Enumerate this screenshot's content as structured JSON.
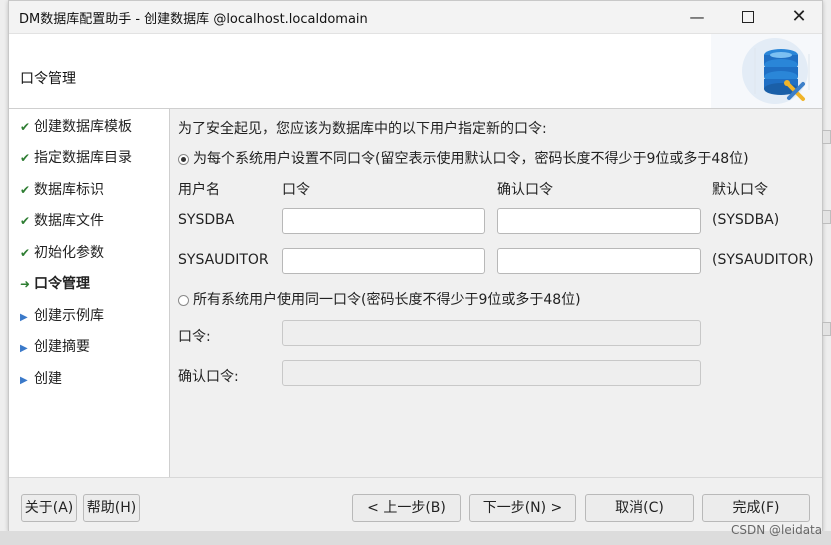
{
  "window": {
    "title": "DM数据库配置助手 - 创建数据库 @localhost.localdomain",
    "controls": {
      "minimize": "—",
      "close": "✕"
    }
  },
  "header": {
    "title": "口令管理",
    "logo_icon": "database-config-icon"
  },
  "sidebar": {
    "steps": [
      {
        "label": "创建数据库模板",
        "state": "done"
      },
      {
        "label": "指定数据库目录",
        "state": "done"
      },
      {
        "label": "数据库标识",
        "state": "done"
      },
      {
        "label": "数据库文件",
        "state": "done"
      },
      {
        "label": "初始化参数",
        "state": "done"
      },
      {
        "label": "口令管理",
        "state": "current"
      },
      {
        "label": "创建示例库",
        "state": "todo"
      },
      {
        "label": "创建摘要",
        "state": "todo"
      },
      {
        "label": "创建",
        "state": "todo"
      }
    ]
  },
  "main": {
    "intro": "为了安全起见，您应该为数据库中的以下用户指定新的口令:",
    "option_separate": "为每个系统用户设置不同口令(留空表示使用默认口令，密码长度不得少于9位或多于48位)",
    "columns": {
      "user": "用户名",
      "password": "口令",
      "confirm": "确认口令",
      "default": "默认口令"
    },
    "rows": [
      {
        "user": "SYSDBA",
        "password": "",
        "confirm": "",
        "default": "(SYSDBA)"
      },
      {
        "user": "SYSAUDITOR",
        "password": "",
        "confirm": "",
        "default": "(SYSAUDITOR)"
      }
    ],
    "option_same": "所有系统用户使用同一口令(密码长度不得少于9位或多于48位)",
    "same_password_label": "口令:",
    "same_confirm_label": "确认口令:",
    "selected_option": "separate"
  },
  "footer": {
    "about": "关于(A)",
    "help": "帮助(H)",
    "prev": "< 上一步(B)",
    "next": "下一步(N) >",
    "cancel": "取消(C)",
    "finish": "完成(F)"
  },
  "watermark": "CSDN @leidata",
  "colors": {
    "done_check": "#2e7d32",
    "todo_arrow": "#3a79c9",
    "logo_blue": "#1f6fc4"
  }
}
